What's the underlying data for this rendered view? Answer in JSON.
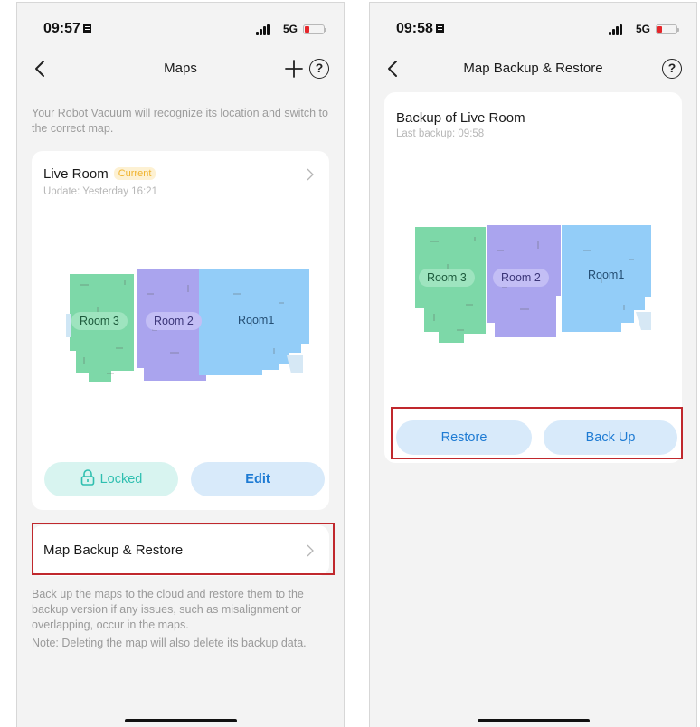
{
  "left_screen": {
    "status": {
      "time": "09:57",
      "network": "5G"
    },
    "nav": {
      "title": "Maps"
    },
    "intro": "Your Robot Vacuum will recognize its location and switch to the correct map.",
    "map_card": {
      "name": "Live Room",
      "badge": "Current",
      "update": "Update: Yesterday 16:21",
      "rooms": [
        "Room 3",
        "Room 2",
        "Room1"
      ],
      "locked_button": "Locked",
      "edit_button": "Edit"
    },
    "backup_row": {
      "label": "Map Backup & Restore"
    },
    "help_text": "Back up the maps to the cloud and restore them to the backup version if any issues, such as misalignment or overlapping, occur in the maps.",
    "note_text": "Note: Deleting the map will also delete its backup data."
  },
  "right_screen": {
    "status": {
      "time": "09:58",
      "network": "5G"
    },
    "nav": {
      "title": "Map Backup & Restore"
    },
    "backup_card": {
      "title": "Backup of Live Room",
      "last_backup": "Last backup: 09:58",
      "rooms": [
        "Room 3",
        "Room 2",
        "Room1"
      ],
      "restore_button": "Restore",
      "backup_button": "Back Up"
    }
  },
  "colors": {
    "room3": "#7dd8a8",
    "room2": "#aaa4ee",
    "room1": "#93cdf8",
    "button_blue_bg": "#d8eafa",
    "button_blue_text": "#1e7bd3",
    "locked_bg": "#d8f4f0",
    "locked_text": "#2fbfb0",
    "highlight": "#c0282d"
  }
}
